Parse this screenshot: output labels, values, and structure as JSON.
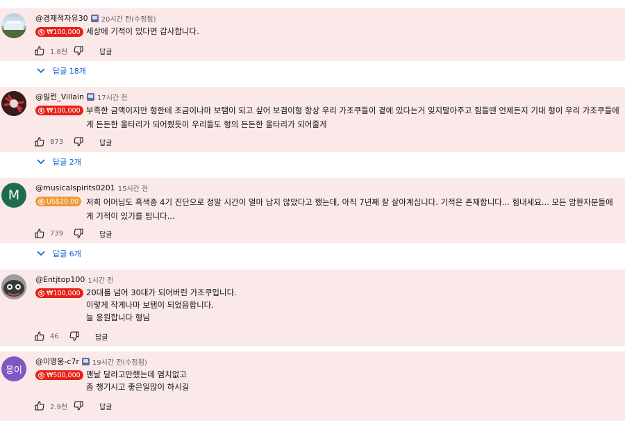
{
  "comments": [
    {
      "author": "@경제적자유30",
      "member_badge": true,
      "time": "20시간 전(수정됨)",
      "donation": "₩100,000",
      "donation_color": "#e62117",
      "text": "세상에 기적이 있다면 감사합니다.",
      "likes": "1.8천",
      "reply_label": "답글",
      "replies_label": "답글 18개",
      "avatar_icon": "landscape-photo-avatar"
    },
    {
      "author": "@빌런_Villain",
      "member_badge": true,
      "time": "17시간 전",
      "donation": "₩100,000",
      "donation_color": "#e62117",
      "text": "부족한 금액이지만 형한테 조금이나마 보탬이 되고 싶어 보겸이형 항상 우리 가조쿠들이 곁에 있다는거 잊지말아주고 힘들땐 언제든지 기대 형이 우리 가조쿠들에게 든든한 울타리가 되어줬듯이 우리들도 형의 든든한 울타리가 되어줄게",
      "likes": "873",
      "reply_label": "답글",
      "replies_label": "답글 2개",
      "avatar_icon": "sticker-avatar"
    },
    {
      "author": "@musicalspirits0201",
      "member_badge": false,
      "time": "15시간 전",
      "donation": "US$20.00",
      "donation_color": "#f09a37",
      "text": "저희 어머님도 흑색종 4기 진단으로 정말 시간이 얼마 남지 않았다고 했는데, 아직 7년째 잘 살아계십니다. 기적은 존재합니다... 힘내세요... 모든 암환자분들에게 기적이 있기를 빕니다...",
      "likes": "739",
      "reply_label": "답글",
      "replies_label": "답글 6개",
      "avatar_letter": "M",
      "avatar_color": "#1f6b4e"
    },
    {
      "author": "@Entjtop100",
      "member_badge": false,
      "time": "1시간 전",
      "donation": "₩100,000",
      "donation_color": "#e62117",
      "text": "20대를 넘어 30대가 되어버린 가조쿠입니다.\n이렇게 작게나마 보탬이 되었음합니다.\n늘 응원합니다 형님",
      "likes": "46",
      "reply_label": "답글",
      "avatar_icon": "cartoon-avatar"
    },
    {
      "author": "@이영웅-c7r",
      "member_badge": true,
      "time": "19시간 전(수정됨)",
      "donation": "₩500,000",
      "donation_color": "#e62117",
      "text": "맨날 달라고만했는데 염치없고\n좀 챙기시고 좋은일많이 하시길",
      "likes": "2.9천",
      "reply_label": "답글",
      "avatar_letter": "몽이",
      "avatar_color": "#7e57c2"
    }
  ],
  "colors": {
    "highlight_bg": "#fbe9e9",
    "link_blue": "#065fd4"
  }
}
